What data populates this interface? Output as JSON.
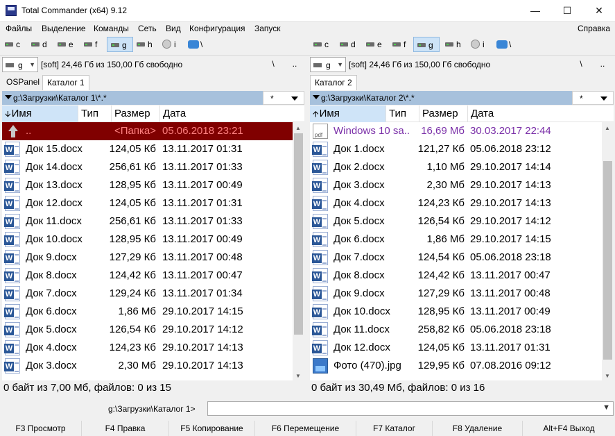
{
  "window": {
    "title": "Total Commander (x64) 9.12",
    "minimize_glyph": "—",
    "maximize_glyph": "☐",
    "close_glyph": "✕"
  },
  "menu": {
    "items": [
      "Файлы",
      "Выделение",
      "Команды",
      "Сеть",
      "Вид",
      "Конфигурация",
      "Запуск"
    ],
    "help": "Справка"
  },
  "drives": [
    "c",
    "d",
    "e",
    "f",
    "g",
    "h",
    "i",
    "\\"
  ],
  "active_drive": "g",
  "left": {
    "drive_select": "g",
    "volume_info": "[soft]  24,46 Гб из 150,00 Гб свободно",
    "root_label": "\\",
    "up_label": "..",
    "tabs": [
      "OSPanel",
      "Каталог 1"
    ],
    "path": "g:\\Загрузки\\Каталог 1\\*.*",
    "filter": "*",
    "columns": [
      "Имя",
      "Тип",
      "Размер",
      "Дата"
    ],
    "sort_glyph": "🡫",
    "rows": [
      {
        "name": "..",
        "size": "<Папка>",
        "date": "05.06.2018 23:21",
        "icon": "up-dir-icon"
      },
      {
        "name": "Док 15.docx",
        "size": "124,05 Кб",
        "date": "13.11.2017 01:31",
        "icon": "word-doc-icon"
      },
      {
        "name": "Док 14.docx",
        "size": "256,61 Кб",
        "date": "13.11.2017 01:33",
        "icon": "word-doc-icon"
      },
      {
        "name": "Док 13.docx",
        "size": "128,95 Кб",
        "date": "13.11.2017 00:49",
        "icon": "word-doc-icon"
      },
      {
        "name": "Док 12.docx",
        "size": "124,05 Кб",
        "date": "13.11.2017 01:31",
        "icon": "word-doc-icon"
      },
      {
        "name": "Док 11.docx",
        "size": "256,61 Кб",
        "date": "13.11.2017 01:33",
        "icon": "word-doc-icon"
      },
      {
        "name": "Док 10.docx",
        "size": "128,95 Кб",
        "date": "13.11.2017 00:49",
        "icon": "word-doc-icon"
      },
      {
        "name": "Док 9.docx",
        "size": "127,29 Кб",
        "date": "13.11.2017 00:48",
        "icon": "word-doc-icon"
      },
      {
        "name": "Док 8.docx",
        "size": "124,42 Кб",
        "date": "13.11.2017 00:47",
        "icon": "word-doc-icon"
      },
      {
        "name": "Док 7.docx",
        "size": "129,24 Кб",
        "date": "13.11.2017 01:34",
        "icon": "word-doc-icon"
      },
      {
        "name": "Док 6.docx",
        "size": "1,86 Мб",
        "date": "29.10.2017 14:15",
        "icon": "word-doc-icon"
      },
      {
        "name": "Док 5.docx",
        "size": "126,54 Кб",
        "date": "29.10.2017 14:12",
        "icon": "word-doc-icon"
      },
      {
        "name": "Док 4.docx",
        "size": "124,23 Кб",
        "date": "29.10.2017 14:13",
        "icon": "word-doc-icon"
      },
      {
        "name": "Док 3.docx",
        "size": "2,30 Мб",
        "date": "29.10.2017 14:13",
        "icon": "word-doc-icon"
      }
    ],
    "status": "0 байт из 7,00 Мб, файлов: 0 из 15"
  },
  "right": {
    "drive_select": "g",
    "volume_info": "[soft]  24,46 Гб из 150,00 Гб свободно",
    "root_label": "\\",
    "up_label": "..",
    "tabs": [
      "Каталог 2"
    ],
    "path": "g:\\Загрузки\\Каталог 2\\*.*",
    "filter": "*",
    "columns": [
      "Имя",
      "Тип",
      "Размер",
      "Дата"
    ],
    "sort_glyph": "🡩",
    "rows": [
      {
        "name": "Windows 10 sa..",
        "size": "16,69 Мб",
        "date": "30.03.2017 22:44",
        "icon": "pdf-icon"
      },
      {
        "name": "Док 1.docx",
        "size": "121,27 Кб",
        "date": "05.06.2018 23:12",
        "icon": "word-doc-icon"
      },
      {
        "name": "Док 2.docx",
        "size": "1,10 Мб",
        "date": "29.10.2017 14:14",
        "icon": "word-doc-icon"
      },
      {
        "name": "Док 3.docx",
        "size": "2,30 Мб",
        "date": "29.10.2017 14:13",
        "icon": "word-doc-icon"
      },
      {
        "name": "Док 4.docx",
        "size": "124,23 Кб",
        "date": "29.10.2017 14:13",
        "icon": "word-doc-icon"
      },
      {
        "name": "Док 5.docx",
        "size": "126,54 Кб",
        "date": "29.10.2017 14:12",
        "icon": "word-doc-icon"
      },
      {
        "name": "Док 6.docx",
        "size": "1,86 Мб",
        "date": "29.10.2017 14:15",
        "icon": "word-doc-icon"
      },
      {
        "name": "Док 7.docx",
        "size": "124,54 Кб",
        "date": "05.06.2018 23:18",
        "icon": "word-doc-icon"
      },
      {
        "name": "Док 8.docx",
        "size": "124,42 Кб",
        "date": "13.11.2017 00:47",
        "icon": "word-doc-icon"
      },
      {
        "name": "Док 9.docx",
        "size": "127,29 Кб",
        "date": "13.11.2017 00:48",
        "icon": "word-doc-icon"
      },
      {
        "name": "Док 10.docx",
        "size": "128,95 Кб",
        "date": "13.11.2017 00:49",
        "icon": "word-doc-icon"
      },
      {
        "name": "Док 11.docx",
        "size": "258,82 Кб",
        "date": "05.06.2018 23:18",
        "icon": "word-doc-icon"
      },
      {
        "name": "Док 12.docx",
        "size": "124,05 Кб",
        "date": "13.11.2017 01:31",
        "icon": "word-doc-icon"
      },
      {
        "name": "Фото (470).jpg",
        "size": "129,95 Кб",
        "date": "07.08.2016 09:12",
        "icon": "jpg-icon"
      }
    ],
    "status": "0 байт из 30,49 Мб, файлов: 0 из 16"
  },
  "cmdline": {
    "path": "g:\\Загрузки\\Каталог 1>",
    "value": ""
  },
  "fkeys": [
    "F3 Просмотр",
    "F4 Правка",
    "F5 Копирование",
    "F6 Перемещение",
    "F7 Каталог",
    "F8 Удаление",
    "Alt+F4 Выход"
  ],
  "colors": {
    "selected_bg": "#800000",
    "selected_fg": "#ff8080",
    "path_bar": "#a7c1dc",
    "sort_header": "#cfe4f8",
    "pdf_name": "#7a2fa8"
  }
}
